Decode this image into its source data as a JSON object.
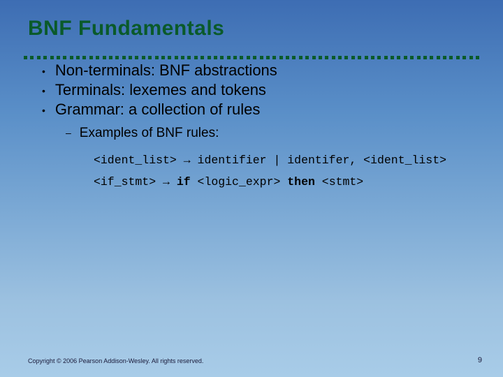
{
  "slide": {
    "title": "BNF Fundamentals",
    "bullets": [
      "Non-terminals: BNF abstractions",
      "Terminals: lexemes and tokens",
      "Grammar: a collection of rules"
    ],
    "sub_bullet": "Examples of BNF rules:",
    "code": {
      "line1_left": "<ident_list> ",
      "line1_arrow": "→",
      "line1_right": " identifier | identifer, <ident_list>",
      "line2_left": "<if_stmt> ",
      "line2_arrow": "→",
      "line2_if": " if ",
      "line2_mid": "<logic_expr> ",
      "line2_then": "then ",
      "line2_end": "<stmt>"
    },
    "copyright": "Copyright © 2006 Pearson Addison-Wesley. All rights reserved.",
    "page_number": "9"
  }
}
